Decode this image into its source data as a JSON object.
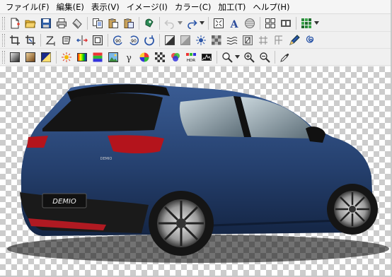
{
  "menu": [
    "ファイル(F)",
    "編集(E)",
    "表示(V)",
    "イメージ(I)",
    "カラー(C)",
    "加工(T)",
    "ヘルプ(H)"
  ],
  "car": {
    "plate_text": "DEMIO",
    "badge_text": "DEMIO",
    "body_color": "#25406e"
  },
  "toolbars": {
    "row1": [
      "new-document-icon",
      "open-folder-icon",
      "save-icon",
      "print-icon",
      "scan-icon",
      "copy-icon",
      "paste-icon",
      "paste-new-icon",
      "capture-icon",
      "undo-icon",
      "redo-icon",
      "fit-window-icon",
      "text-icon",
      "sphere-icon",
      "thumbnail-grid-icon",
      "filmstrip-icon",
      "color-grid-icon"
    ],
    "row2": [
      "crop-icon",
      "auto-crop-icon",
      "resize-icon",
      "canvas-size-icon",
      "flip-icon",
      "border-icon",
      "rotate-left-icon",
      "rotate-right-icon",
      "rotate-free-icon",
      "sharpen-icon",
      "blur-icon",
      "noise-icon",
      "mosaic-icon",
      "wave-icon",
      "emboss-icon",
      "edge-icon",
      "oil-icon",
      "pen-icon",
      "spiral-icon"
    ],
    "row3": [
      "grayscale-icon",
      "sepia-icon",
      "negative-icon",
      "brightness-icon",
      "color-balance-icon",
      "hue-icon",
      "image-adjust-icon",
      "gamma-icon",
      "color-wheel-icon",
      "halftone-icon",
      "rgb-channels-icon",
      "hdr-icon",
      "histogram-icon",
      "zoom-dropdown-icon",
      "zoom-in-icon",
      "zoom-out-icon",
      "eyedropper-icon"
    ]
  }
}
